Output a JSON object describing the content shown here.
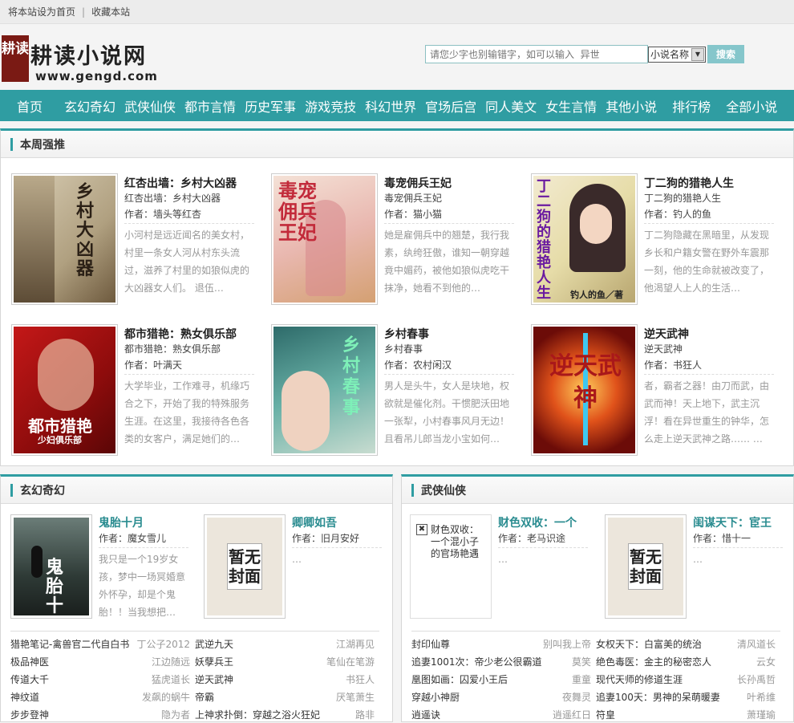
{
  "topbar": {
    "set_home": "将本站设为首页",
    "sep": "|",
    "bookmark": "收藏本站"
  },
  "logo": {
    "seal": "耕读",
    "text": "耕读小说网",
    "url": "www.gengd.com"
  },
  "search": {
    "placeholder": "请您少字也别输错字，如可以输入  异世",
    "type_selected": "小说名称",
    "button": "搜索"
  },
  "nav": [
    "首页",
    "玄幻奇幻",
    "武侠仙侠",
    "都市言情",
    "历史军事",
    "游戏竞技",
    "科幻世界",
    "官场后宫",
    "同人美文",
    "女生言情",
    "其他小说",
    "排行榜",
    "全部小说"
  ],
  "weekly": {
    "title": "本周强推",
    "books": [
      {
        "title": "红杏出墙：乡村大凶器",
        "subtitle": "红杏出墙：乡村大凶器",
        "author": "作者：墙头等红杏",
        "desc": "小河村是远近闻名的美女村，村里一条女人河从村东头流过，滋养了村里的如狼似虎的大凶器女人们。  退伍…",
        "cover_text": "乡村大凶器"
      },
      {
        "title": "毒宠佣兵王妃",
        "subtitle": "毒宠佣兵王妃",
        "author": "作者：猫小猫",
        "desc": "她是雇佣兵中的翘楚，我行我素，纨绔狂傲，谁知一朝穿越竟中媚药，被他如狼似虎吃干抹净，她看不到他的…",
        "cover_text": "毒宠佣兵王妃"
      },
      {
        "title": "丁二狗的猎艳人生",
        "subtitle": "丁二狗的猎艳人生",
        "author": "作者：钓人的鱼",
        "desc": "丁二狗隐藏在黑暗里，从发现乡长和户籍女警在野外车震那一刻，他的生命就被改变了，他渴望人上人的生活…",
        "cover_text": "丁二狗的猎艳人生",
        "cover_sub": "钓人的鱼／著"
      },
      {
        "title": "都市猎艳：熟女俱乐部",
        "subtitle": "都市猎艳：熟女俱乐部",
        "author": "作者：叶满天",
        "desc": "大学毕业，工作难寻，机缘巧合之下，开始了我的特殊服务生涯。在这里，我接待各色各类的女客户，满足她们的…",
        "cover_text": "都市猎艳",
        "cover_sub": "少妇俱乐部"
      },
      {
        "title": "乡村春事",
        "subtitle": "乡村春事",
        "author": "作者：农村闲汉",
        "desc": "男人是头牛，女人是块地，权欲就是催化剂。干惯肥沃田地一张犁，小村春事风月无边！且看吊儿郎当龙小宝如何…",
        "cover_text": "乡村春事"
      },
      {
        "title": "逆天武神",
        "subtitle": "逆天武神",
        "author": "作者：书狂人",
        "desc": "者，霸者之器！由刀而武，由武而神！天上地下，武主沉浮！看在异世重生的钟华，怎么走上逆天武神之路……  …",
        "cover_text": "逆天武神"
      }
    ]
  },
  "xuanhuan": {
    "title": "玄幻奇幻",
    "featured": [
      {
        "title": "鬼胎十月",
        "author": "作者：魔女雪儿",
        "desc": "我只是一个19岁女孩，梦中一场冥婚意外怀孕，却是个鬼胎！！当我想把…",
        "cover_text": "鬼胎十月"
      },
      {
        "title": "卿卿如吾",
        "author": "作者：旧月安好",
        "desc": "…",
        "cover_text": "暂无封面"
      }
    ],
    "list": [
      [
        {
          "name": "猎艳笔记-禽兽官二代自白书",
          "author": "丁公子2012"
        },
        {
          "name": "武逆九天",
          "author": "江湖再见"
        }
      ],
      [
        {
          "name": "极品神医",
          "author": "江边随远"
        },
        {
          "name": "妖孽兵王",
          "author": "笔仙在笔游"
        }
      ],
      [
        {
          "name": "传道大千",
          "author": "猛虎道长"
        },
        {
          "name": "逆天武神",
          "author": "书狂人"
        }
      ],
      [
        {
          "name": "神纹道",
          "author": "发飙的蜗牛"
        },
        {
          "name": "帝霸",
          "author": "厌笔萧生"
        }
      ],
      [
        {
          "name": "步步登神",
          "author": "隐为者"
        },
        {
          "name": "上神求扑倒：穿越之浴火狂妃",
          "author": "路非"
        }
      ]
    ]
  },
  "wuxia": {
    "title": "武侠仙侠",
    "featured": [
      {
        "title": "财色双收：一个",
        "author": "作者：老马识途",
        "desc": "…",
        "cover_alt": "财色双收：一个混小子的官场艳遇"
      },
      {
        "title": "闺谋天下：宦王",
        "author": "作者：惜十一",
        "desc": "…",
        "cover_text": "暂无封面"
      }
    ],
    "list": [
      [
        {
          "name": "封印仙尊",
          "author": "别叫我上帝"
        },
        {
          "name": "女权天下：白富美的统治",
          "author": "清风道长"
        }
      ],
      [
        {
          "name": "追妻1001次：帝少老公很霸道",
          "author": "莫笑"
        },
        {
          "name": "绝色毒医：金主的秘密恋人",
          "author": "云女"
        }
      ],
      [
        {
          "name": "凰图如画：囚爱小王后",
          "author": "重童"
        },
        {
          "name": "现代天师的修道生涯",
          "author": "长孙禹哲"
        }
      ],
      [
        {
          "name": "穿越小神厨",
          "author": "夜舞灵"
        },
        {
          "name": "追妻100天：男神的呆萌暖妻",
          "author": "叶希维"
        }
      ],
      [
        {
          "name": "逍遥诀",
          "author": "逍遥红日"
        },
        {
          "name": "符皇",
          "author": "萧瑾瑜"
        }
      ]
    ]
  }
}
